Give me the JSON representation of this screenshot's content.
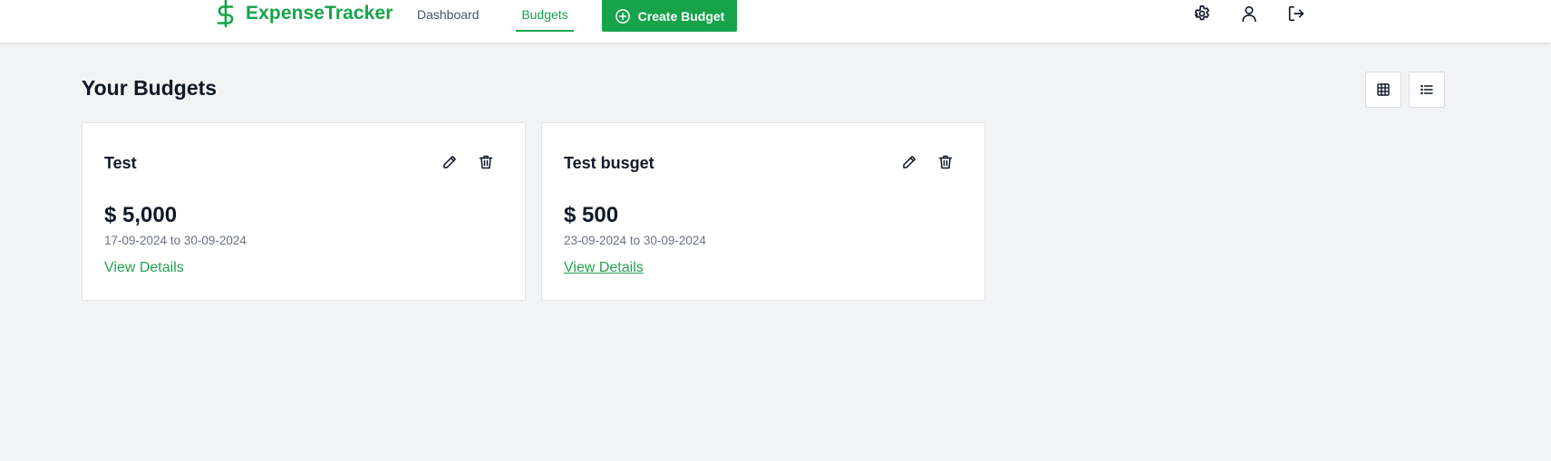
{
  "brand": {
    "name": "ExpenseTracker",
    "icon": "dollar-sign-icon",
    "color": "#16a34a"
  },
  "nav": {
    "items": [
      {
        "label": "Dashboard",
        "active": false
      },
      {
        "label": "Budgets",
        "active": true
      }
    ],
    "create_button": {
      "label": "Create Budget",
      "icon": "plus-circle-icon"
    }
  },
  "header_icons": [
    "settings-icon",
    "user-icon",
    "logout-icon"
  ],
  "page": {
    "title": "Your Budgets",
    "view_toggles": [
      "grid-view-icon",
      "list-view-icon"
    ]
  },
  "budgets": [
    {
      "name": "Test",
      "amount": "$ 5,000",
      "start": "17-09-2024",
      "end": "30-09-2024",
      "range_sep": "to",
      "link": "View Details"
    },
    {
      "name": "Test busget",
      "amount": "$ 500",
      "start": "23-09-2024",
      "end": "30-09-2024",
      "range_sep": "to",
      "link": "View Details"
    }
  ],
  "colors": {
    "accent": "#16a34a",
    "background": "#f2f3f5",
    "card": "#ffffff"
  }
}
